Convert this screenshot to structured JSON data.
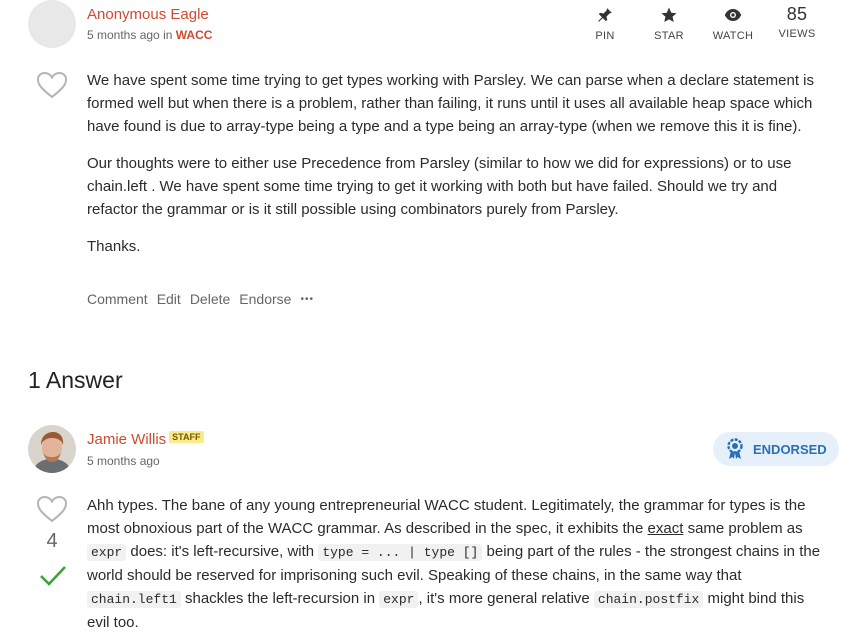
{
  "question": {
    "author": "Anonymous Eagle",
    "time": "5 months ago",
    "in_label": "in",
    "category": "WACC",
    "actions": {
      "pin": "PIN",
      "star": "STAR",
      "watch": "WATCH",
      "views_count": "85",
      "views_label": "VIEWS"
    },
    "paragraphs": [
      "We have spent some time trying to get types working with Parsley. We can parse when a declare statement is formed well but when there is a problem, rather than failing, it runs until it uses all available heap space which have found is due to array-type being a type and a type being an array-type (when we remove this it is fine).",
      "Our thoughts were to either use Precedence from Parsley (similar to how we did for expressions) or to use chain.left . We have spent some time trying to get it working with both but have failed. Should we try and refactor the grammar or is it still possible using combinators purely from Parsley.",
      "Thanks."
    ],
    "links": {
      "comment": "Comment",
      "edit": "Edit",
      "delete": "Delete",
      "endorse": "Endorse",
      "more": "•••"
    }
  },
  "answers_header": "1 Answer",
  "answer": {
    "author": "Jamie Willis",
    "badge": "STAFF",
    "time": "5 months ago",
    "endorsed_label": "ENDORSED",
    "votes": "4",
    "text": {
      "t1": "Ahh types. The bane of any young entrepreneurial WACC student. Legitimately, the grammar for types is the most obnoxious part of the WACC grammar. As described in the spec, it exhibits the ",
      "t2": "exact",
      "t3": " same problem as ",
      "c1": "expr",
      "t4": " does: it's left-recursive, with ",
      "c2": "type = ... | type []",
      "t5": " being part of the rules - the strongest chains in the world should be reserved for imprisoning such evil. Speaking of these chains, in the same way that ",
      "c3": "chain.left1",
      "t6": " shackles the left-recursion in ",
      "c4": "expr",
      "t7": ", it's more general relative ",
      "c5": "chain.postfix",
      "t8": " might bind this evil too."
    }
  },
  "colors": {
    "accent": "#d1492e",
    "endorsed_bg": "#e6f0fb",
    "endorsed_text": "#2a6fb4",
    "check": "#3aa33a"
  }
}
